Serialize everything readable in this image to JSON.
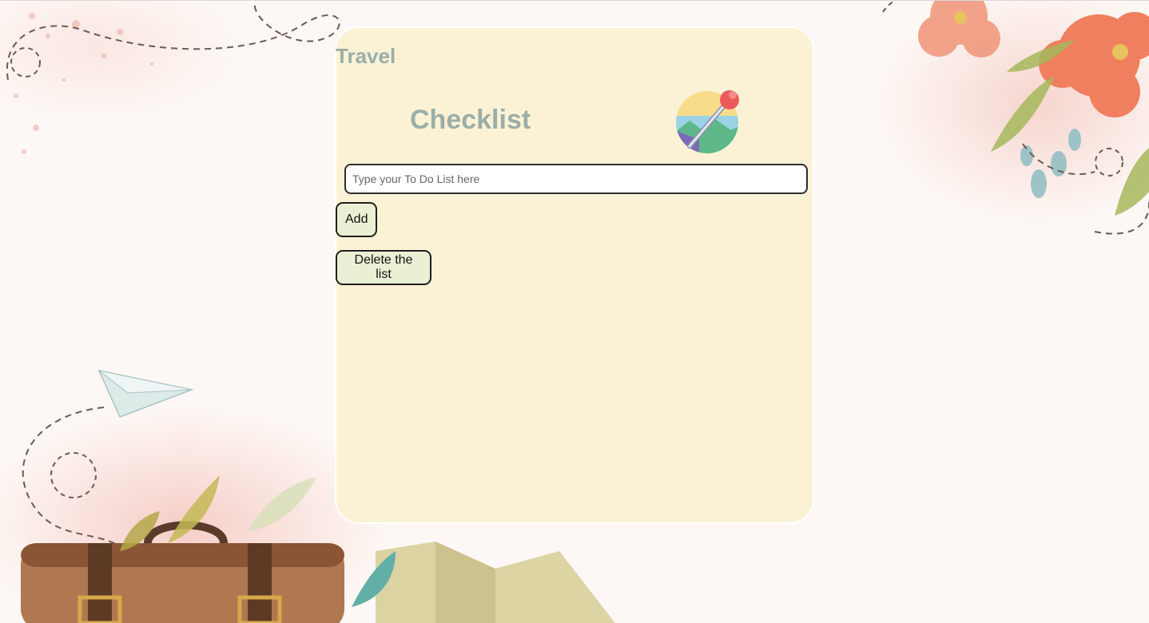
{
  "header": {
    "title_line1": "Travel",
    "title_line2": "Checklist"
  },
  "input": {
    "placeholder": "Type your To Do List here",
    "value": ""
  },
  "buttons": {
    "add_label": "Add",
    "delete_label": "Delete the list"
  },
  "icons": {
    "header_icon": "map-pin-icon"
  },
  "colors": {
    "card_background": "#fbf2d6",
    "title_color": "#9aaea8",
    "button_background": "#eaf0d4",
    "page_background": "#fdf8f5"
  },
  "todo_items": []
}
